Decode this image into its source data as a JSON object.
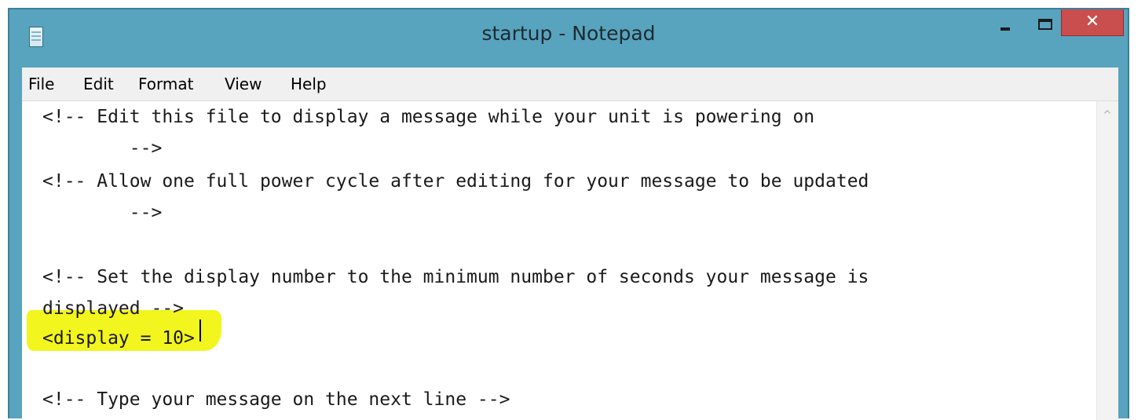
{
  "window": {
    "title": "startup - Notepad",
    "close_glyph": "✕",
    "icons": {
      "app": "notepad-icon",
      "minimize": "minimize-icon",
      "maximize": "maximize-icon",
      "close": "close-icon",
      "scroll_up": "chevron-up-icon"
    },
    "colors": {
      "titlebar": "#58a3be",
      "close_button": "#c94e4e",
      "highlight": "#f2f51e"
    }
  },
  "menu": {
    "file": "File",
    "edit": "Edit",
    "format": "Format",
    "view": "View",
    "help": "Help"
  },
  "editor": {
    "lines": [
      "<!-- Edit this file to display a message while your unit is powering on",
      "        -->",
      "<!-- Allow one full power cycle after editing for your message to be updated",
      "        -->",
      "",
      "<!-- Set the display number to the minimum number of seconds your message is",
      "displayed -->",
      "<display = 10>",
      "",
      "<!-- Type your message on the next line -->"
    ]
  }
}
